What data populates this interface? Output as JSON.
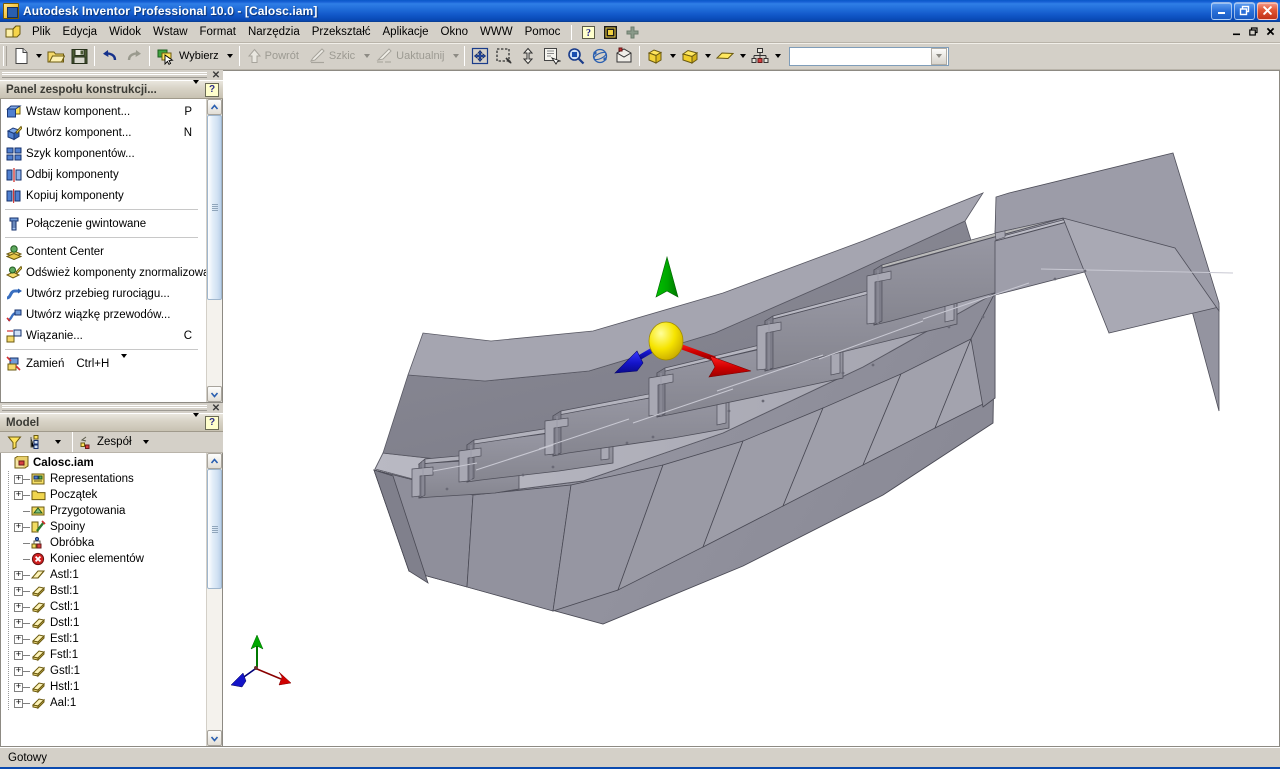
{
  "window": {
    "title": "Autodesk Inventor Professional 10.0 - [Calosc.iam]",
    "app_icon": "inventor-icon",
    "minimize": "–",
    "maximize": "❐",
    "close": "✕"
  },
  "menubar": {
    "app_icon": "document-assembly-icon",
    "items": [
      {
        "label": "Plik"
      },
      {
        "label": "Edycja"
      },
      {
        "label": "Widok"
      },
      {
        "label": "Wstaw"
      },
      {
        "label": "Format"
      },
      {
        "label": "Narzędzia"
      },
      {
        "label": "Przekształć"
      },
      {
        "label": "Aplikacje"
      },
      {
        "label": "Okno"
      },
      {
        "label": "WWW"
      },
      {
        "label": "Pomoc"
      }
    ],
    "extra_buttons": [
      {
        "name": "help-question-icon",
        "glyph": "?"
      },
      {
        "name": "visual-syllabus-icon",
        "glyph": "▦"
      },
      {
        "name": "add-plus-icon",
        "glyph": "✚"
      }
    ],
    "mdi_buttons": [
      {
        "name": "mdi-minimize",
        "glyph": "_"
      },
      {
        "name": "mdi-restore",
        "glyph": "❐"
      },
      {
        "name": "mdi-close",
        "glyph": "✕"
      }
    ]
  },
  "toolbar": {
    "new_label": "New",
    "open_label": "Open",
    "save_label": "Save",
    "undo_label": "Undo",
    "redo_label": "Redo",
    "select_label": "Wybierz",
    "return_label": "Powrót",
    "sketch_label": "Szkic",
    "update_label": "Uaktualnij",
    "combo_value": "",
    "combo_placeholder": ""
  },
  "panel": {
    "gripbar_close": "✕",
    "title": "Panel zespołu konstrukcji...",
    "help_glyph": "?",
    "items": [
      {
        "icon": "place-component-icon",
        "label": "Wstaw komponent...",
        "key": "P",
        "sep_after": false
      },
      {
        "icon": "create-component-icon",
        "label": "Utwórz komponent...",
        "key": "N",
        "sep_after": false
      },
      {
        "icon": "pattern-component-icon",
        "label": "Szyk komponentów...",
        "key": "",
        "sep_after": false
      },
      {
        "icon": "mirror-component-icon",
        "label": "Odbij komponenty",
        "key": "",
        "sep_after": false
      },
      {
        "icon": "copy-component-icon",
        "label": "Kopiuj komponenty",
        "key": "",
        "sep_after": true
      },
      {
        "icon": "bolted-connection-icon",
        "label": "Połączenie gwintowane",
        "key": "",
        "sep_after": true
      },
      {
        "icon": "content-center-icon",
        "label": "Content Center",
        "key": "",
        "sep_after": false
      },
      {
        "icon": "refresh-standard-icon",
        "label": "Odśwież komponenty znormalizowane",
        "key": "",
        "sep_after": false
      },
      {
        "icon": "create-pipe-run-icon",
        "label": "Utwórz przebieg rurociągu...",
        "key": "",
        "sep_after": false
      },
      {
        "icon": "create-harness-icon",
        "label": "Utwórz wiązkę przewodów...",
        "key": "",
        "sep_after": false
      },
      {
        "icon": "constraint-icon",
        "label": "Wiązanie...",
        "key": "C",
        "sep_after": true
      },
      {
        "icon": "replace-component-icon",
        "label": "Zamień",
        "key": "Ctrl+H",
        "sep_after": false
      }
    ]
  },
  "model": {
    "gripbar_close": "✕",
    "title": "Model",
    "help_glyph": "?",
    "toolbar": [
      {
        "name": "filter-icon",
        "label": ""
      },
      {
        "name": "tree-view-icon",
        "label": ""
      },
      {
        "name": "assembly-view-icon",
        "label": "Zespół"
      }
    ],
    "tree": [
      {
        "level": 0,
        "expander": "",
        "icon": "assembly-doc-icon",
        "label": "Calosc.iam",
        "bold": true
      },
      {
        "level": 1,
        "expander": "+",
        "icon": "representations-icon",
        "label": "Representations",
        "bold": false
      },
      {
        "level": 1,
        "expander": "+",
        "icon": "folder-icon",
        "label": "Początek",
        "bold": false
      },
      {
        "level": 1,
        "expander": "",
        "icon": "preparations-icon",
        "label": "Przygotowania",
        "bold": false
      },
      {
        "level": 1,
        "expander": "+",
        "icon": "welds-icon",
        "label": "Spoiny",
        "bold": false
      },
      {
        "level": 1,
        "expander": "",
        "icon": "machining-icon",
        "label": "Obróbka",
        "bold": false
      },
      {
        "level": 1,
        "expander": "",
        "icon": "end-of-features-icon",
        "label": "Koniec elementów",
        "bold": false
      },
      {
        "level": 1,
        "expander": "+",
        "icon": "part-sheet-icon",
        "label": "Astl:1",
        "bold": false
      },
      {
        "level": 1,
        "expander": "+",
        "icon": "part-icon",
        "label": "Bstl:1",
        "bold": false
      },
      {
        "level": 1,
        "expander": "+",
        "icon": "part-icon",
        "label": "Cstl:1",
        "bold": false
      },
      {
        "level": 1,
        "expander": "+",
        "icon": "part-icon",
        "label": "Dstl:1",
        "bold": false
      },
      {
        "level": 1,
        "expander": "+",
        "icon": "part-icon",
        "label": "Estl:1",
        "bold": false
      },
      {
        "level": 1,
        "expander": "+",
        "icon": "part-icon",
        "label": "Fstl:1",
        "bold": false
      },
      {
        "level": 1,
        "expander": "+",
        "icon": "part-icon",
        "label": "Gstl:1",
        "bold": false
      },
      {
        "level": 1,
        "expander": "+",
        "icon": "part-icon",
        "label": "Hstl:1",
        "bold": false
      },
      {
        "level": 1,
        "expander": "+",
        "icon": "part-icon",
        "label": "Aal:1",
        "bold": false
      }
    ]
  },
  "viewport": {
    "name": "3d-model-view",
    "model_description": "Boat hull assembly, shaded grey isometric view",
    "triad_center": {
      "name": "3d-move-triad"
    },
    "axis_colors": {
      "x": "#d40000",
      "y": "#00a000",
      "z": "#0000d0",
      "center": "#f2e000"
    },
    "corner_triad": {
      "name": "coordinate-triad-indicator"
    }
  },
  "statusbar": {
    "text": "Gotowy"
  },
  "colors": {
    "titlebar_blue": "#1258c9",
    "face_light": "#9a9aa6",
    "face_mid": "#8a8a96",
    "face_dark": "#76767f",
    "chrome": "#d4d0c8"
  }
}
